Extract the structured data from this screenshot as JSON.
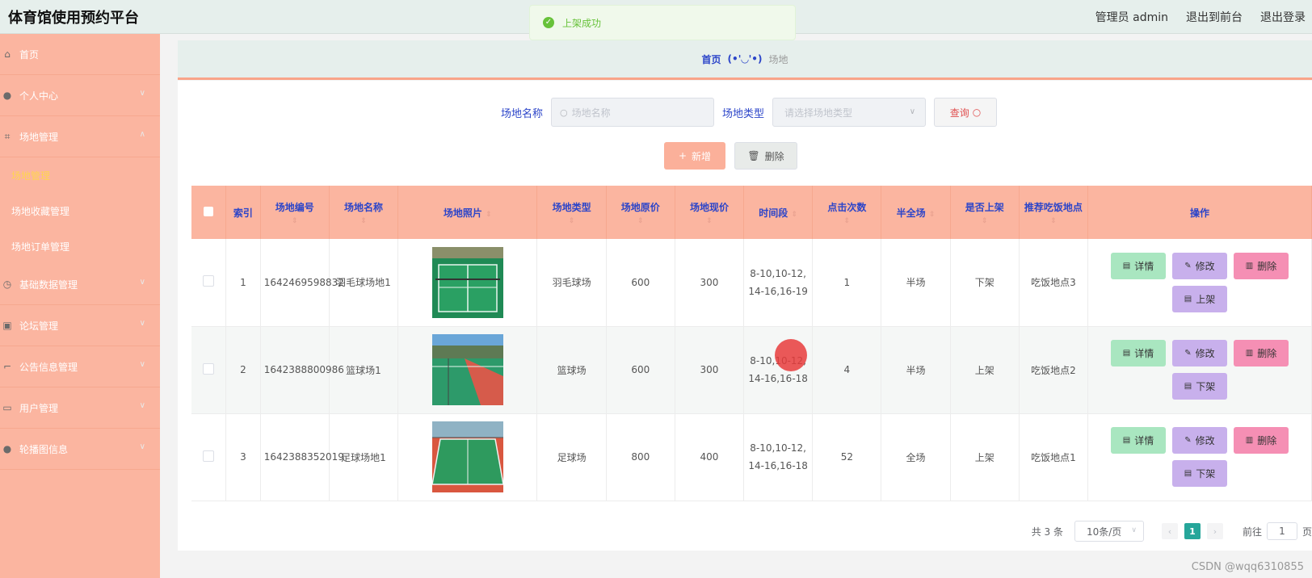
{
  "header": {
    "title": "体育馆使用预约平台",
    "admin_label": "管理员 admin",
    "back_front": "退出到前台",
    "logout": "退出登录"
  },
  "toast": {
    "message": "上架成功"
  },
  "sidebar": {
    "items": [
      {
        "label": "首页"
      },
      {
        "label": "个人中心"
      },
      {
        "label": "场地管理"
      },
      {
        "label": "场地管理"
      },
      {
        "label": "场地收藏管理"
      },
      {
        "label": "场地订单管理"
      },
      {
        "label": "基础数据管理"
      },
      {
        "label": "论坛管理"
      },
      {
        "label": "公告信息管理"
      },
      {
        "label": "用户管理"
      },
      {
        "label": "轮播图信息"
      }
    ]
  },
  "breadcrumb": {
    "home": "首页",
    "face": "(•'◡'•)",
    "current": "场地"
  },
  "search": {
    "name_label": "场地名称",
    "name_placeholder": "场地名称",
    "type_label": "场地类型",
    "type_placeholder": "请选择场地类型",
    "query_button": "查询"
  },
  "actions": {
    "add": "新增",
    "delete": "删除"
  },
  "table": {
    "columns": [
      "索引",
      "场地编号",
      "场地名称",
      "场地照片",
      "场地类型",
      "场地原价",
      "场地现价",
      "时间段",
      "点击次数",
      "半全场",
      "是否上架",
      "推荐吃饭地点",
      "操作"
    ],
    "rows": [
      {
        "index": "1",
        "code": "1642469598832",
        "name": "羽毛球场地1",
        "type": "羽毛球场",
        "orig": "600",
        "now": "300",
        "time": "8-10,10-12,14-16,16-19",
        "clicks": "1",
        "half": "半场",
        "shelf": "下架",
        "food": "吃饭地点3",
        "toggle": "上架"
      },
      {
        "index": "2",
        "code": "1642388800986",
        "name": "篮球场1",
        "type": "篮球场",
        "orig": "600",
        "now": "300",
        "time": "8-10,10-12,14-16,16-18",
        "clicks": "4",
        "half": "半场",
        "shelf": "上架",
        "food": "吃饭地点2",
        "toggle": "下架"
      },
      {
        "index": "3",
        "code": "1642388352019",
        "name": "足球场地1",
        "type": "足球场",
        "orig": "800",
        "now": "400",
        "time": "8-10,10-12,14-16,16-18",
        "clicks": "52",
        "half": "全场",
        "shelf": "上架",
        "food": "吃饭地点1",
        "toggle": "下架"
      }
    ],
    "op_labels": {
      "detail": "详情",
      "edit": "修改",
      "delete": "删除"
    }
  },
  "pager": {
    "total": "共 3 条",
    "page_size": "10条/页",
    "current": "1",
    "goto": "前往",
    "goto_value": "1",
    "page_suffix": "页"
  },
  "watermark": "CSDN @wqq6310855",
  "colors": {
    "sidebar": "#fbb5a0",
    "header_bg": "#e6efec",
    "accent_blue": "#2c45c9",
    "pager_active": "#26a69a"
  }
}
